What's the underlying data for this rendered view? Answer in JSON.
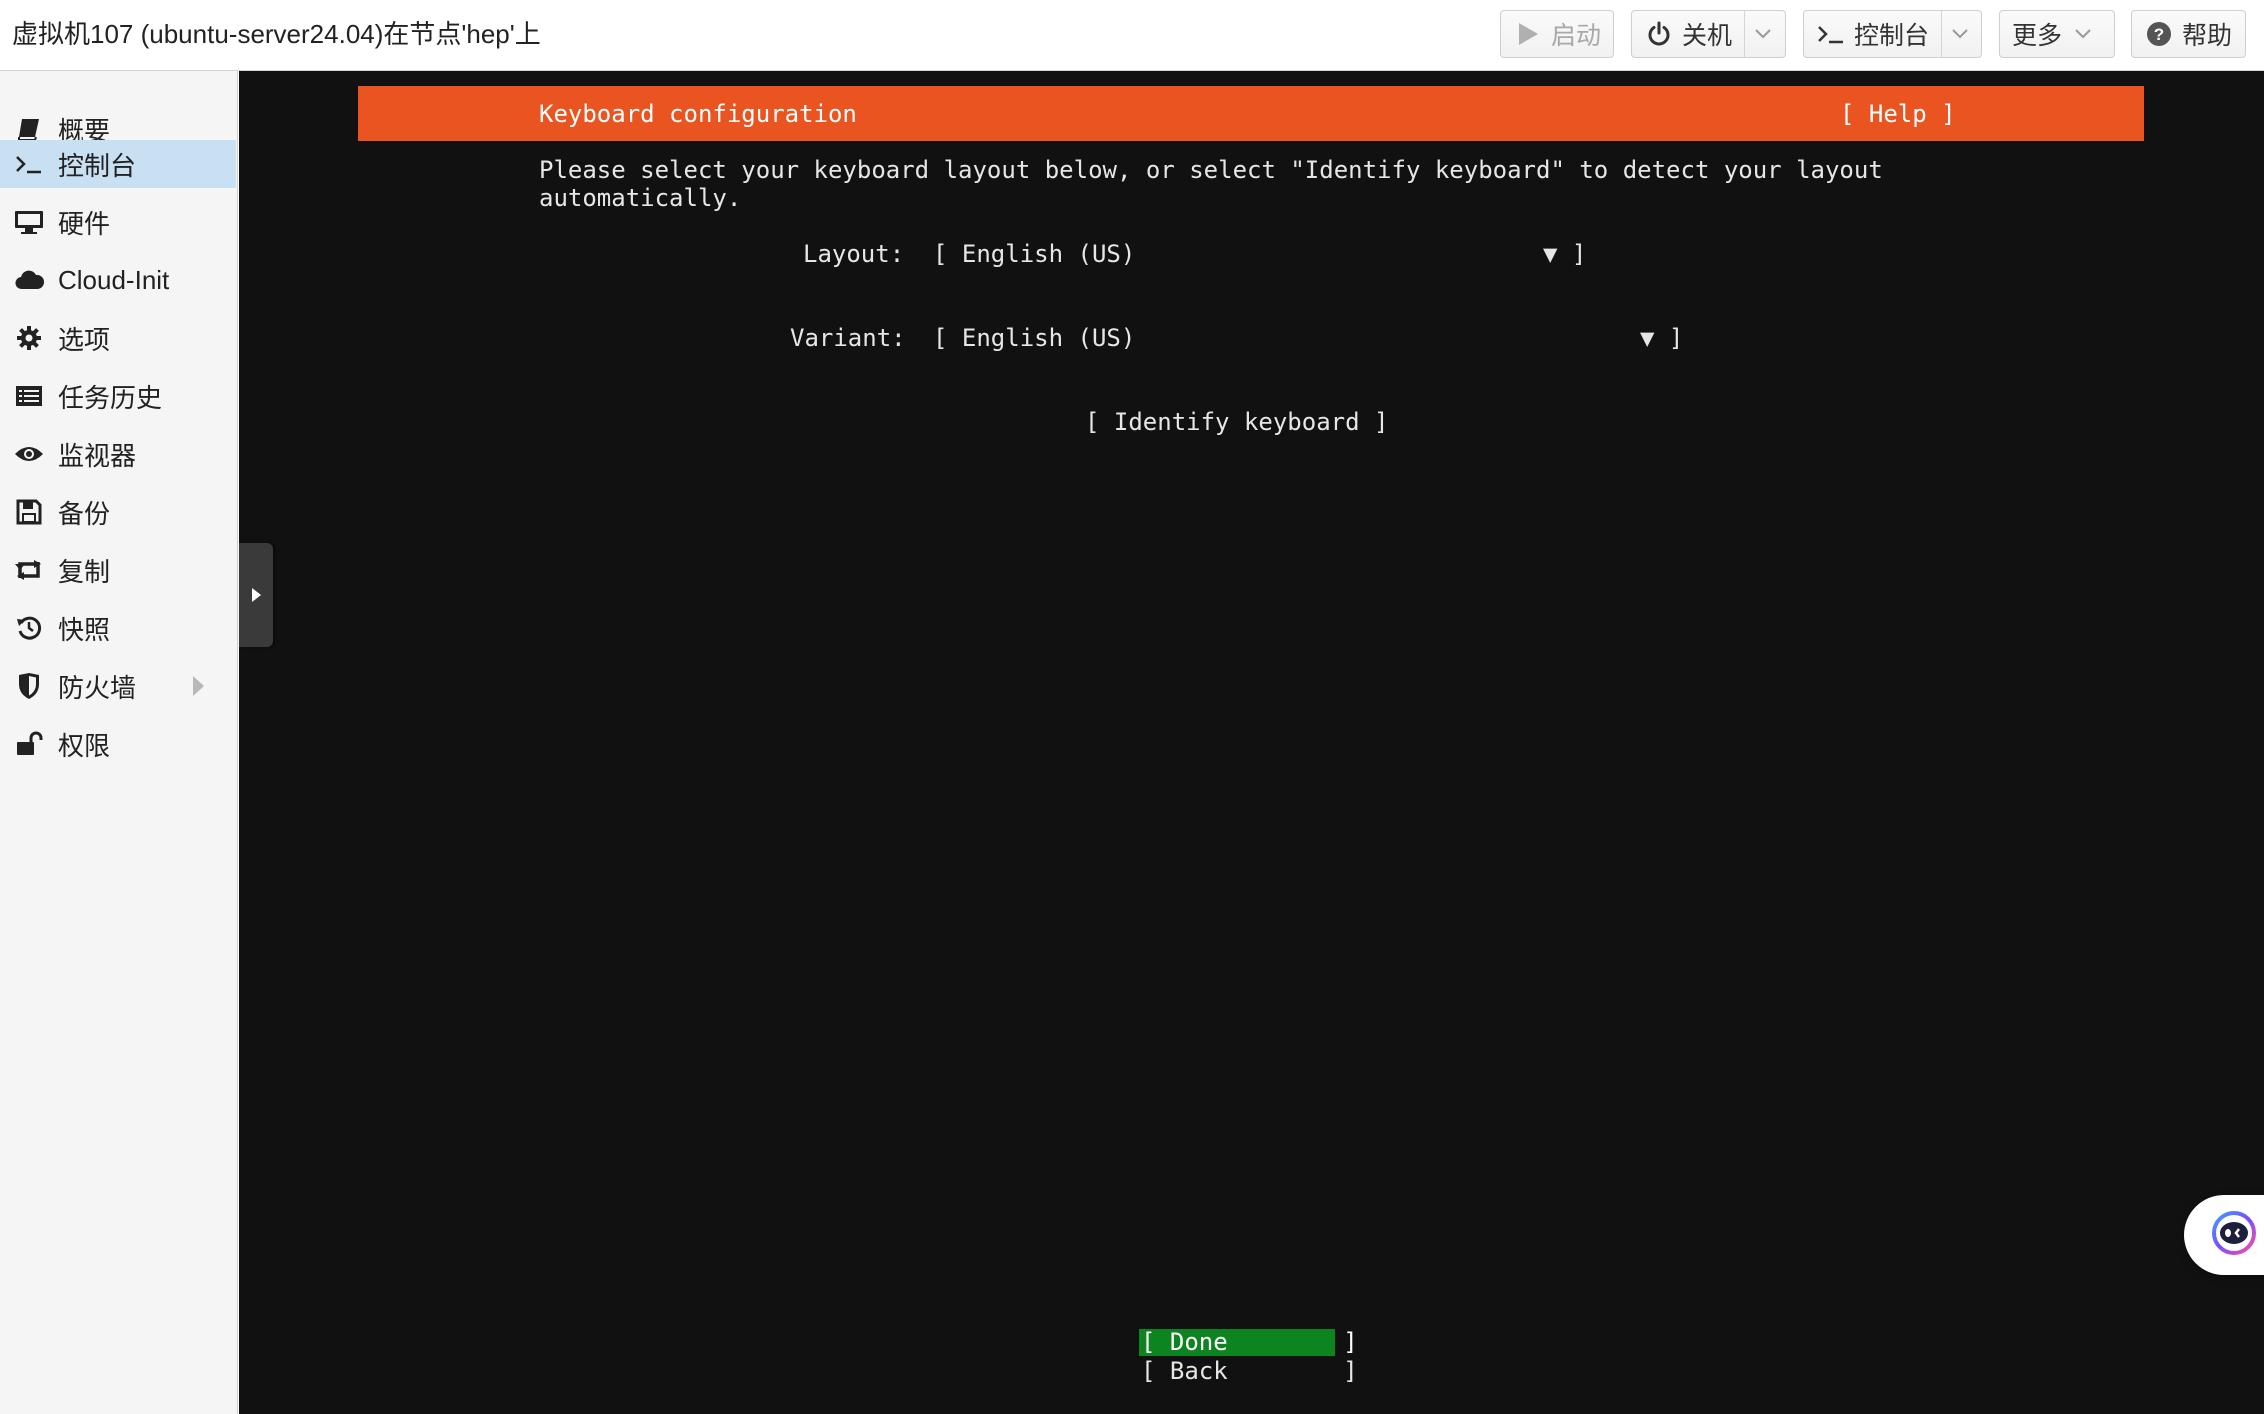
{
  "window": {
    "title": "虚拟机107 (ubuntu-server24.04)在节点'hep'上"
  },
  "toolbar": {
    "start": {
      "label": "启动",
      "icon": "play-icon",
      "disabled": true
    },
    "shutdown": {
      "label": "关机",
      "icon": "power-icon"
    },
    "console": {
      "label": "控制台",
      "icon": "terminal-icon"
    },
    "more": {
      "label": "更多"
    },
    "help": {
      "label": "帮助",
      "icon": "question-circle-icon"
    }
  },
  "sidebar": {
    "items": [
      {
        "label": "概要",
        "icon": "book-icon",
        "active": false
      },
      {
        "label": "控制台",
        "icon": "terminal-icon",
        "active": true
      },
      {
        "label": "硬件",
        "icon": "monitor-icon",
        "active": false
      },
      {
        "label": "Cloud-Init",
        "icon": "cloud-icon",
        "active": false
      },
      {
        "label": "选项",
        "icon": "gear-icon",
        "active": false
      },
      {
        "label": "任务历史",
        "icon": "list-icon",
        "active": false
      },
      {
        "label": "监视器",
        "icon": "eye-icon",
        "active": false
      },
      {
        "label": "备份",
        "icon": "floppy-icon",
        "active": false
      },
      {
        "label": "复制",
        "icon": "retweet-icon",
        "active": false
      },
      {
        "label": "快照",
        "icon": "history-icon",
        "active": false
      },
      {
        "label": "防火墙",
        "icon": "shield-icon",
        "active": false,
        "expandable": true
      },
      {
        "label": "权限",
        "icon": "unlock-icon",
        "active": false
      }
    ]
  },
  "installer": {
    "header_title": "Keyboard configuration",
    "help": "[ Help ]",
    "intro_line1": "Please select your keyboard layout below, or select \"Identify keyboard\" to detect your layout",
    "intro_line2": "automatically.",
    "layout_label": "Layout:",
    "layout_value": "[ English (US)",
    "layout_arrow": "▼ ]",
    "variant_label": "Variant:",
    "variant_value": "[ English (US)",
    "variant_arrow": "▼ ]",
    "identify": "[ Identify keyboard ]",
    "done": "[ Done        ]",
    "back": "[ Back        ]"
  },
  "colors": {
    "ubuntu_orange": "#e95420",
    "done_green": "#0e8420",
    "sidebar_active": "#c9dff2",
    "console_bg": "#111111"
  }
}
